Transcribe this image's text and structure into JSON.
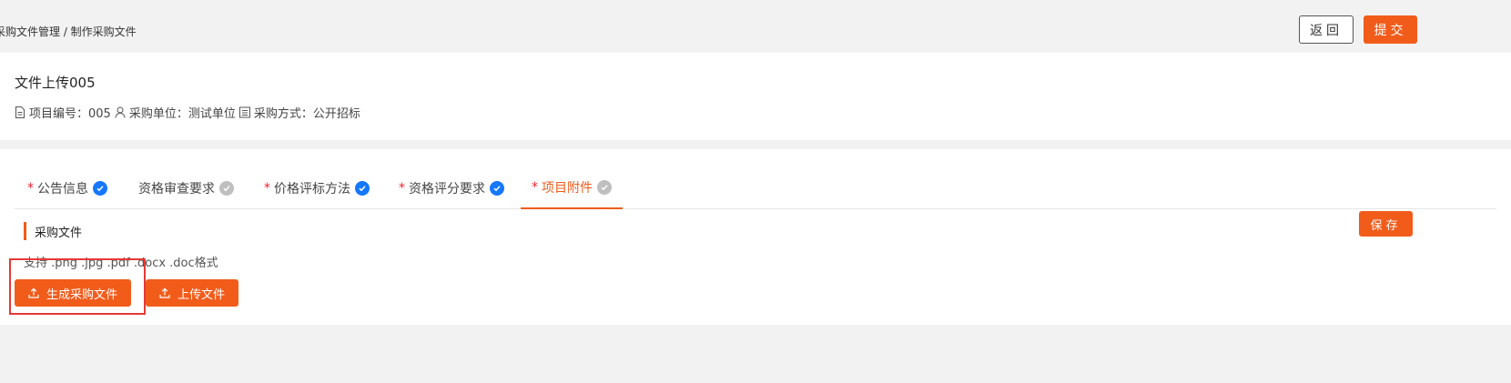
{
  "header": {
    "breadcrumb": "采购文件管理 / 制作采购文件",
    "back_label": "返回",
    "submit_label": "提交"
  },
  "project": {
    "title": "文件上传005",
    "code_text": "项目编号：005",
    "unit_text": "采购单位：测试单位",
    "method_text": "采购方式：公开招标"
  },
  "tabs": [
    {
      "label": "公告信息",
      "required": true,
      "status": "done"
    },
    {
      "label": "资格审查要求",
      "required": false,
      "status": "pending"
    },
    {
      "label": "价格评标方法",
      "required": true,
      "status": "done"
    },
    {
      "label": "资格评分要求",
      "required": true,
      "status": "done"
    },
    {
      "label": "项目附件",
      "required": true,
      "status": "pending",
      "active": true
    }
  ],
  "tab_required_mark": "*",
  "section": {
    "title": "采购文件",
    "hint": "支持 .png .jpg .pdf .docx .doc格式",
    "save_label": "保存",
    "generate_label": "生成采购文件",
    "upload_label": "上传文件"
  },
  "colors": {
    "primary": "#f25c1b",
    "done_check": "#1677ff",
    "pending_check": "#bfbfbf",
    "highlight_box": "#e53935"
  }
}
